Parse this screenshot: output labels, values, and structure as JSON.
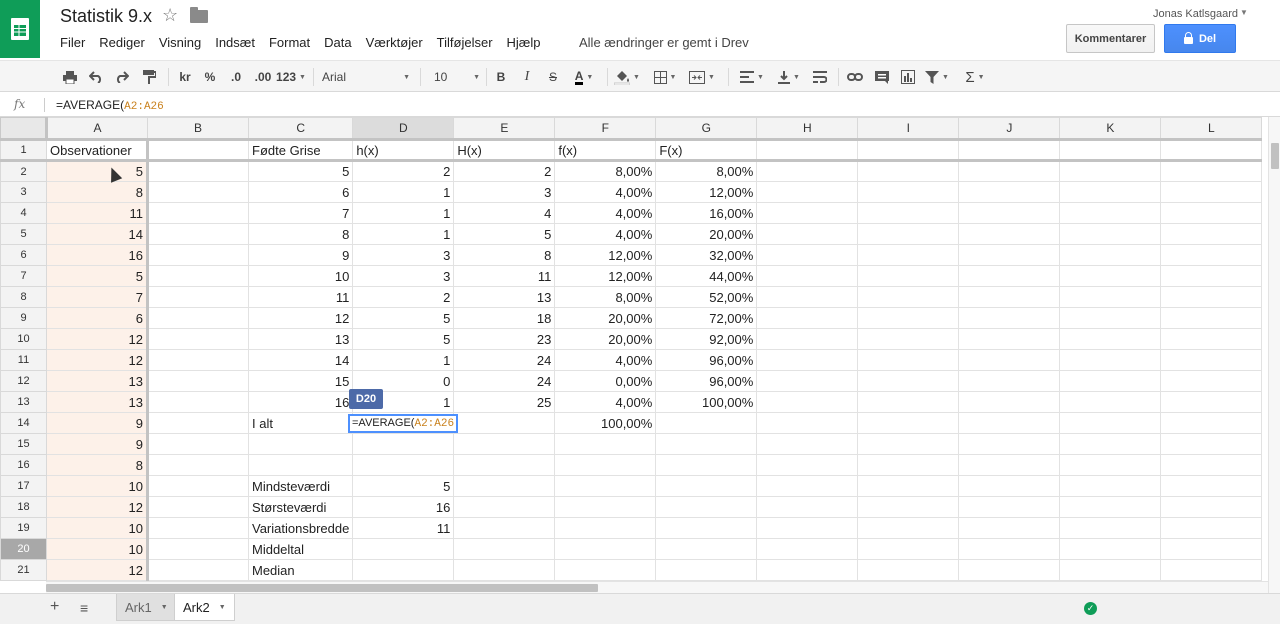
{
  "app": {
    "title": "Statistik 9.x",
    "save_status": "Alle ændringer er gemt i Drev",
    "user": "Jonas Katlsgaard",
    "comments_label": "Kommentarer",
    "share_label": "Del",
    "colors": {
      "brand": "#0f9d58",
      "share": "#4d90fe",
      "copy_range": "#fdf1e9",
      "tooltip": "#4d6aa8"
    }
  },
  "menu": [
    "Filer",
    "Rediger",
    "Visning",
    "Indsæt",
    "Format",
    "Data",
    "Værktøjer",
    "Tilføjelser",
    "Hjælp"
  ],
  "toolbar": {
    "currency": "kr",
    "percent": "%",
    "decimal_less": ".0",
    "decimal_more": ".00",
    "more_formats": "123",
    "font": "Arial",
    "font_size": "10",
    "bold": "B",
    "italic": "I",
    "strike": "S",
    "text_color": "A",
    "sum": "Σ",
    "icons": [
      "print-icon",
      "undo-icon",
      "redo-icon",
      "paint-format-icon",
      "fill-color-icon",
      "borders-icon",
      "merge-icon",
      "align-left-icon",
      "align-bottom-icon",
      "wrap-text-icon",
      "link-icon",
      "comment-icon",
      "chart-icon",
      "filter-icon",
      "functions-icon"
    ]
  },
  "formula_bar": {
    "fx": "fx",
    "prefix": "=AVERAGE(",
    "ref": "A2:A26"
  },
  "grid": {
    "columns": [
      "A",
      "B",
      "C",
      "D",
      "E",
      "F",
      "G",
      "H",
      "I",
      "J",
      "K",
      "L"
    ],
    "active_col": "D",
    "rows": [
      {
        "n": "1",
        "A": "Observationer",
        "B": "",
        "C": "Fødte Grise",
        "D": "h(x)",
        "E": "H(x)",
        "F": "f(x)",
        "G": "F(x)"
      },
      {
        "n": "2",
        "A": "5",
        "B": "",
        "C": "5",
        "D": "2",
        "E": "2",
        "F": "8,00%",
        "G": "8,00%"
      },
      {
        "n": "3",
        "A": "8",
        "B": "",
        "C": "6",
        "D": "1",
        "E": "3",
        "F": "4,00%",
        "G": "12,00%"
      },
      {
        "n": "4",
        "A": "11",
        "B": "",
        "C": "7",
        "D": "1",
        "E": "4",
        "F": "4,00%",
        "G": "16,00%"
      },
      {
        "n": "5",
        "A": "14",
        "B": "",
        "C": "8",
        "D": "1",
        "E": "5",
        "F": "4,00%",
        "G": "20,00%"
      },
      {
        "n": "6",
        "A": "16",
        "B": "",
        "C": "9",
        "D": "3",
        "E": "8",
        "F": "12,00%",
        "G": "32,00%"
      },
      {
        "n": "7",
        "A": "5",
        "B": "",
        "C": "10",
        "D": "3",
        "E": "11",
        "F": "12,00%",
        "G": "44,00%"
      },
      {
        "n": "8",
        "A": "7",
        "B": "",
        "C": "11",
        "D": "2",
        "E": "13",
        "F": "8,00%",
        "G": "52,00%"
      },
      {
        "n": "9",
        "A": "6",
        "B": "",
        "C": "12",
        "D": "5",
        "E": "18",
        "F": "20,00%",
        "G": "72,00%"
      },
      {
        "n": "10",
        "A": "12",
        "B": "",
        "C": "13",
        "D": "5",
        "E": "23",
        "F": "20,00%",
        "G": "92,00%"
      },
      {
        "n": "11",
        "A": "12",
        "B": "",
        "C": "14",
        "D": "1",
        "E": "24",
        "F": "4,00%",
        "G": "96,00%"
      },
      {
        "n": "12",
        "A": "13",
        "B": "",
        "C": "15",
        "D": "0",
        "E": "24",
        "F": "0,00%",
        "G": "96,00%"
      },
      {
        "n": "13",
        "A": "13",
        "B": "",
        "C": "16",
        "D": "1",
        "E": "25",
        "F": "4,00%",
        "G": "100,00%"
      },
      {
        "n": "14",
        "A": "9",
        "B": "",
        "C": "I alt",
        "D": "",
        "E": "",
        "F": "100,00%",
        "G": ""
      },
      {
        "n": "15",
        "A": "9",
        "B": "",
        "C": "",
        "D": "",
        "E": "",
        "F": "",
        "G": ""
      },
      {
        "n": "16",
        "A": "8",
        "B": "",
        "C": "",
        "D": "",
        "E": "",
        "F": "",
        "G": ""
      },
      {
        "n": "17",
        "A": "10",
        "B": "",
        "C": "Mindsteværdi",
        "D": "5",
        "E": "",
        "F": "",
        "G": ""
      },
      {
        "n": "18",
        "A": "12",
        "B": "",
        "C": "Størsteværdi",
        "D": "16",
        "E": "",
        "F": "",
        "G": ""
      },
      {
        "n": "19",
        "A": "10",
        "B": "",
        "C": "Variationsbredde",
        "D": "11",
        "E": "",
        "F": "",
        "G": ""
      },
      {
        "n": "20",
        "A": "10",
        "B": "",
        "C": "Middeltal",
        "D": "",
        "E": "",
        "F": "",
        "G": ""
      },
      {
        "n": "21",
        "A": "12",
        "B": "",
        "C": "Median",
        "D": "",
        "E": "",
        "F": "",
        "G": ""
      }
    ],
    "active_row": "20"
  },
  "editor": {
    "prefix": "=AVERAGE(",
    "ref": "A2:A26",
    "cell_ref": "D20"
  },
  "sheets": [
    {
      "label": "Ark1",
      "active": false
    },
    {
      "label": "Ark2",
      "active": true
    }
  ]
}
